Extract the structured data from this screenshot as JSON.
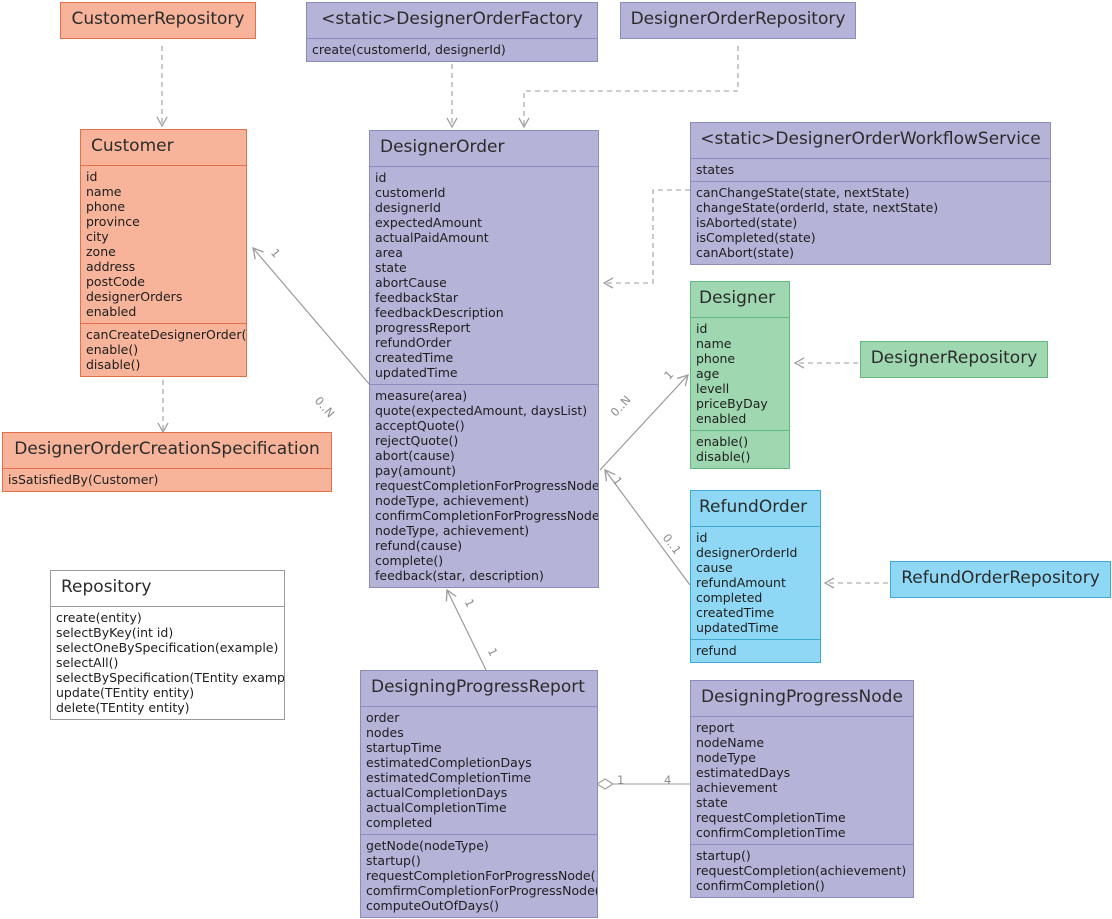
{
  "diagram": {
    "type": "uml-class-diagram",
    "background": "#ffffff",
    "colors": {
      "purple_fill": "#b5b3d8",
      "purple_border": "#8b8bbd",
      "salmon_fill": "#f7b49a",
      "salmon_border": "#e2704a",
      "green_fill": "#9fd8b0",
      "green_border": "#63b880",
      "blue_fill": "#8fd8f5",
      "blue_border": "#3fa9d6",
      "white_fill": "#ffffff",
      "white_border": "#9a9a9a",
      "edge": "#9b9b9b"
    }
  },
  "classes": {
    "customer_repository": {
      "title": "CustomerRepository",
      "attributes": [],
      "operations": []
    },
    "designer_order_factory": {
      "title": "<static>DesignerOrderFactory",
      "attributes": [],
      "operations": [
        "create(customerId, designerId)"
      ]
    },
    "designer_order_repository": {
      "title": "DesignerOrderRepository",
      "attributes": [],
      "operations": []
    },
    "customer": {
      "title": "Customer",
      "attributes": [
        "id",
        "name",
        "phone",
        "province",
        "city",
        "zone",
        "address",
        "postCode",
        "designerOrders",
        "enabled"
      ],
      "operations": [
        "canCreateDesignerOrder()",
        "enable()",
        "disable()"
      ]
    },
    "designer_order": {
      "title": "DesignerOrder",
      "attributes": [
        "id",
        "customerId",
        "designerId",
        "expectedAmount",
        "actualPaidAmount",
        "area",
        "state",
        "abortCause",
        "feedbackStar",
        "feedbackDescription",
        "progressReport",
        "refundOrder",
        "createdTime",
        "updatedTime"
      ],
      "operations": [
        "measure(area)",
        "quote(expectedAmount, daysList)",
        "acceptQuote()",
        "rejectQuote()",
        "abort(cause)",
        "pay(amount)",
        "requestCompletionForProgressNode(",
        "nodeType, achievement)",
        "confirmCompletionForProgressNode(",
        "nodeType, achievement)",
        "refund(cause)",
        "complete()",
        "feedback(star, description)"
      ]
    },
    "designer_order_workflow_service": {
      "title": "<static>DesignerOrderWorkflowService",
      "attributes": [
        "states"
      ],
      "operations": [
        "canChangeState(state, nextState)",
        "changeState(orderId, state, nextState)",
        "isAborted(state)",
        "isCompleted(state)",
        "canAbort(state)"
      ]
    },
    "designer": {
      "title": "Designer",
      "attributes": [
        "id",
        "name",
        "phone",
        "age",
        "levell",
        "priceByDay",
        "enabled"
      ],
      "operations": [
        "enable()",
        "disable()"
      ]
    },
    "designer_repository": {
      "title": "DesignerRepository",
      "attributes": [],
      "operations": []
    },
    "designer_order_creation_specification": {
      "title": "DesignerOrderCreationSpecification",
      "attributes": [],
      "operations": [
        "isSatisfiedBy(Customer)"
      ]
    },
    "refund_order": {
      "title": "RefundOrder",
      "attributes": [
        "id",
        "designerOrderId",
        "cause",
        "refundAmount",
        "completed",
        "createdTime",
        "updatedTime"
      ],
      "operations": [
        "refund"
      ]
    },
    "refund_order_repository": {
      "title": "RefundOrderRepository",
      "attributes": [],
      "operations": []
    },
    "repository": {
      "title": "Repository",
      "attributes": [],
      "operations": [
        "create(entity)",
        "selectByKey(int id)",
        "selectOneBySpecification(example)",
        "selectAll()",
        "selectBySpecification(TEntity example)",
        "update(TEntity entity)",
        "delete(TEntity entity)"
      ]
    },
    "designing_progress_report": {
      "title": "DesigningProgressReport",
      "attributes": [
        "order",
        "nodes",
        "startupTime",
        "estimatedCompletionDays",
        "estimatedCompletionTime",
        "actualCompletionDays",
        "actualCompletionTime",
        "completed"
      ],
      "operations": [
        "getNode(nodeType)",
        "startup()",
        "requestCompletionForProgressNode()",
        "comfirmCompletionForProgressNode()",
        "computeOutOfDays()"
      ]
    },
    "designing_progress_node": {
      "title": "DesigningProgressNode",
      "attributes": [
        "report",
        "nodeName",
        "nodeType",
        "estimatedDays",
        "achievement",
        "state",
        "requestCompletionTime",
        "confirmCompletionTime"
      ],
      "operations": [
        "startup()",
        "requestCompletion(achievement)",
        "confirmCompletion()"
      ]
    }
  },
  "multiplicities": {
    "customer_side": "1",
    "designer_order_to_customer": "0..N",
    "designer_order_to_designer": "0..N",
    "designer_side": "1",
    "designer_order_to_refund": "1",
    "refund_order_side": "0..1",
    "designer_order_to_report": "1",
    "report_to_designer_order": "1",
    "report_to_node": "1",
    "node_to_report": "4"
  }
}
